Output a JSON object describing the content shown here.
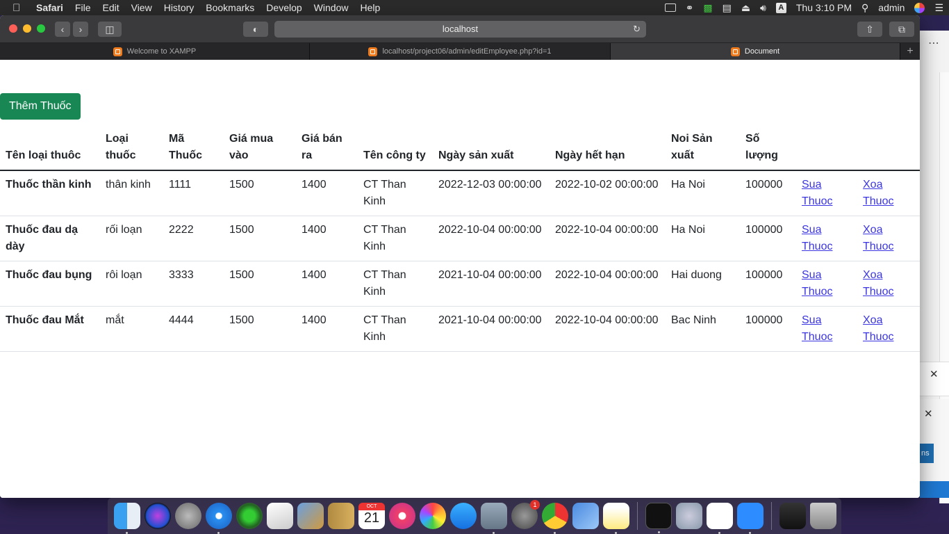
{
  "menubar": {
    "app": "Safari",
    "items": [
      "File",
      "Edit",
      "View",
      "History",
      "Bookmarks",
      "Develop",
      "Window",
      "Help"
    ],
    "input_source": "A",
    "clock": "Thu 3:10 PM",
    "user": "admin"
  },
  "browser": {
    "address": "localhost",
    "tabs": [
      {
        "label": "Welcome to XAMPP"
      },
      {
        "label": "localhost/project06/admin/editEmployee.php?id=1"
      },
      {
        "label": "Document"
      }
    ]
  },
  "page": {
    "add_button": "Thêm Thuốc",
    "columns": [
      "Tên loại thuôc",
      "Loại thuốc",
      "Mã Thuốc",
      "Giá mua vào",
      "Giá bán ra",
      "Tên công ty",
      "Ngày sản xuất",
      "Ngày hết hạn",
      "Noi Sản xuất",
      "Số lượng",
      "",
      ""
    ],
    "rows": [
      {
        "name": "Thuốc thần kinh",
        "type": "thân kinh",
        "code": "1111",
        "buy": "1500",
        "sell": "1400",
        "company": "CT Than Kinh",
        "mfg": "2022-12-03 00:00:00",
        "exp": "2022-10-02 00:00:00",
        "place": "Ha Noi",
        "qty": "100000",
        "edit": "Sua Thuoc",
        "delete": "Xoa Thuoc"
      },
      {
        "name": "Thuốc đau dạ dày",
        "type": "rối loạn",
        "code": "2222",
        "buy": "1500",
        "sell": "1400",
        "company": "CT Than Kinh",
        "mfg": "2022-10-04 00:00:00",
        "exp": "2022-10-04 00:00:00",
        "place": "Ha Noi",
        "qty": "100000",
        "edit": "Sua Thuoc",
        "delete": "Xoa Thuoc"
      },
      {
        "name": "Thuốc đau bụng",
        "type": "rôi loạn",
        "code": "3333",
        "buy": "1500",
        "sell": "1400",
        "company": "CT Than Kinh",
        "mfg": "2021-10-04 00:00:00",
        "exp": "2022-10-04 00:00:00",
        "place": "Hai duong",
        "qty": "100000",
        "edit": "Sua Thuoc",
        "delete": "Xoa Thuoc"
      },
      {
        "name": "Thuốc đau Mắt",
        "type": "mắt",
        "code": "4444",
        "buy": "1500",
        "sell": "1400",
        "company": "CT Than Kinh",
        "mfg": "2021-10-04 00:00:00",
        "exp": "2022-10-04 00:00:00",
        "place": "Bac Ninh",
        "qty": "100000",
        "edit": "Sua Thuoc",
        "delete": "Xoa Thuoc"
      }
    ]
  },
  "side_window": {
    "button_fragment": "ns"
  },
  "dock": {
    "calendar_month": "OCT",
    "calendar_day": "21",
    "sysprefs_badge": "1"
  },
  "colors": {
    "add_button": "#198754",
    "link": "#3b35e0",
    "menubar": "#2b2b2b"
  }
}
